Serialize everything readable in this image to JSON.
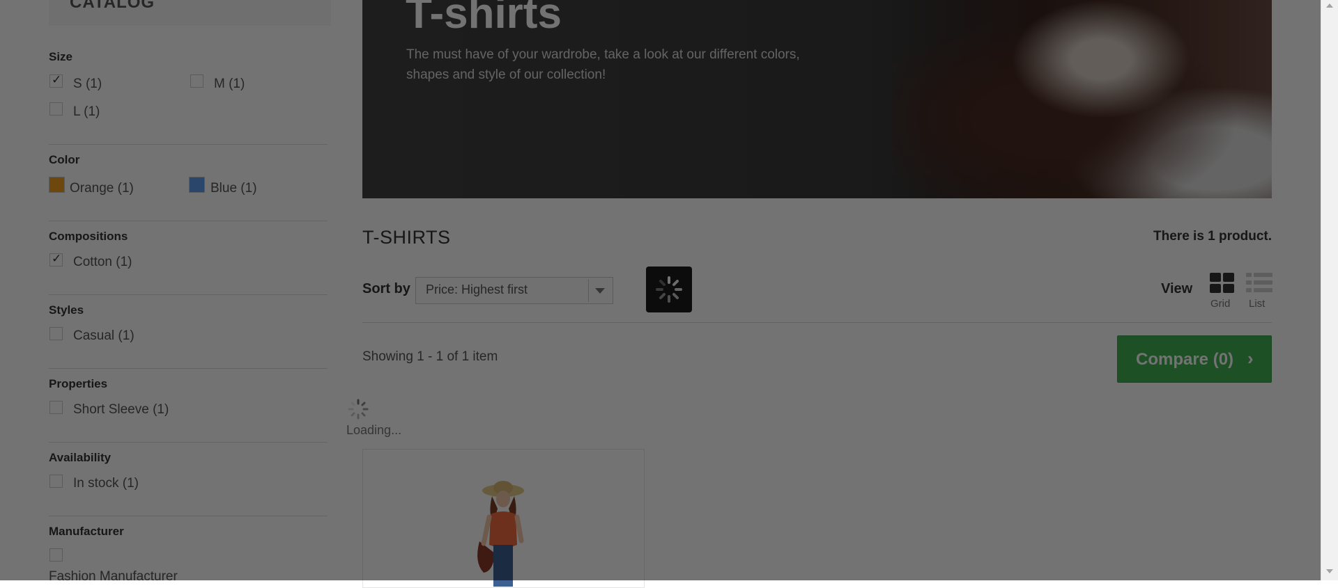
{
  "sidebar": {
    "catalog_title": "CATALOG",
    "facets": {
      "size": {
        "title": "Size",
        "options": [
          {
            "label": "S (1)",
            "checked": true
          },
          {
            "label": "M (1)",
            "checked": false
          },
          {
            "label": "L (1)",
            "checked": false
          }
        ]
      },
      "color": {
        "title": "Color",
        "options": [
          {
            "label": "Orange (1)",
            "color": "#f39d1e"
          },
          {
            "label": "Blue (1)",
            "color": "#5d9cec"
          }
        ]
      },
      "compositions": {
        "title": "Compositions",
        "options": [
          {
            "label": "Cotton (1)",
            "checked": true
          }
        ]
      },
      "styles": {
        "title": "Styles",
        "options": [
          {
            "label": "Casual (1)",
            "checked": false
          }
        ]
      },
      "properties": {
        "title": "Properties",
        "options": [
          {
            "label": "Short Sleeve (1)",
            "checked": false
          }
        ]
      },
      "availability": {
        "title": "Availability",
        "options": [
          {
            "label": "In stock (1)",
            "checked": false
          }
        ]
      },
      "manufacturer": {
        "title": "Manufacturer",
        "options": [
          {
            "label": "Fashion Manufacturer",
            "checked": false
          }
        ]
      }
    }
  },
  "banner": {
    "title": "T-shirts",
    "description": "The must have of your wardrobe, take a look at our different colors, shapes and style of our collection!"
  },
  "category": {
    "name": "T-SHIRTS",
    "product_count": "There is 1 product."
  },
  "toolbar": {
    "sort_label": "Sort by",
    "sort_value": "Price: Highest first",
    "view_label": "View",
    "grid_label": "Grid",
    "list_label": "List",
    "showing": "Showing 1 - 1 of 1 item",
    "compare_label": "Compare (0)",
    "compare_chevron": "›"
  },
  "loading": {
    "text": "Loading..."
  },
  "colors": {
    "accent_green": "#43b155",
    "overlay": "rgba(0,0,0,0.55)"
  },
  "icons": [
    "chevron-down-icon",
    "spinner-icon",
    "grid-view-icon",
    "list-view-icon",
    "chevron-right-icon",
    "checkmark-icon"
  ]
}
